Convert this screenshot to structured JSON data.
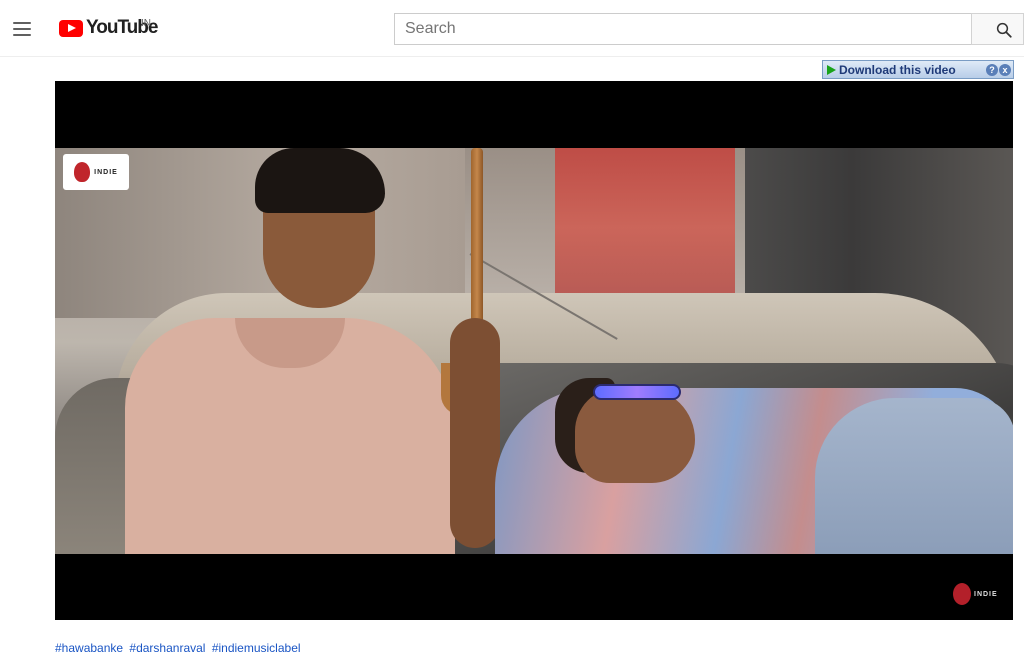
{
  "header": {
    "menu_icon": "hamburger-menu-icon",
    "logo_text": "YouTube",
    "logo_region": "IN",
    "search": {
      "placeholder": "Search",
      "value": ""
    },
    "search_icon": "magnifier-icon"
  },
  "download_helper": {
    "label": "Download this video",
    "help_label": "?",
    "close_label": "x"
  },
  "player": {
    "overlay_logo_text": "INDIE",
    "watermark_text": "INDIE"
  },
  "hashtags": [
    "#hawabanke",
    "#darshanraval",
    "#indiemusiclabel"
  ],
  "colors": {
    "youtube_red": "#ff0000",
    "link_blue": "#1a55c4",
    "download_text": "#1f3a78"
  }
}
